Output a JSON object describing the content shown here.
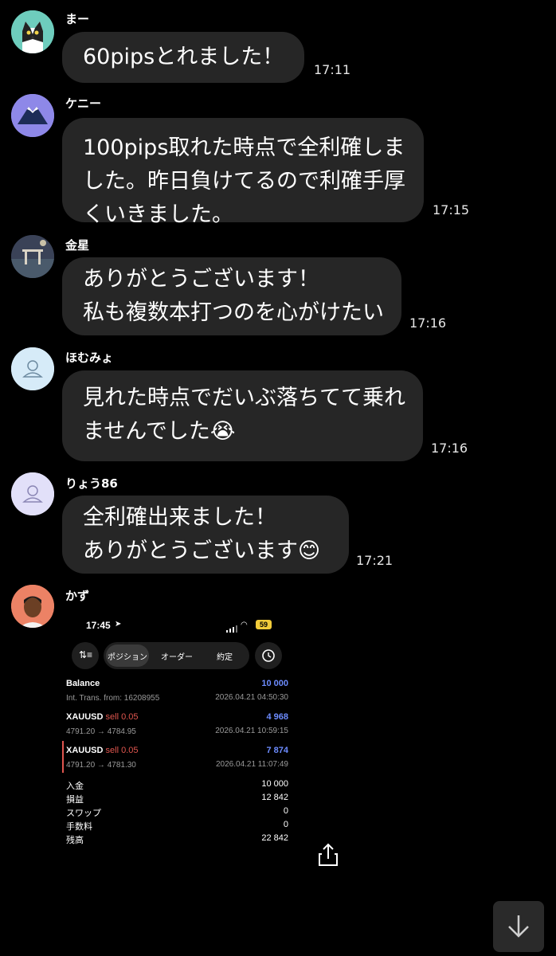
{
  "messages": [
    {
      "sender": "まー",
      "text": "60pipsとれました！",
      "time": "17:11"
    },
    {
      "sender": "ケニー",
      "text": "100pips取れた時点で全利確しま\nした。昨日負けてるので利確手厚\nくいきました。",
      "time": "17:15"
    },
    {
      "sender": "金星",
      "text": "ありがとうございます！\n私も複数本打つのを心がけたい",
      "time": "17:16"
    },
    {
      "sender": "ほむみょ",
      "text": "見れた時点でだいぶ落ちてて乗れ\nませんでした😭",
      "time": "17:16"
    },
    {
      "sender": "りょう86",
      "text": "全利確出来ました！\nありがとうございます😊",
      "time": "17:21"
    },
    {
      "sender": "かず"
    }
  ],
  "screenshot": {
    "status_time": "17:45",
    "battery": "59",
    "tabs": [
      "ポジション",
      "オーダー",
      "約定"
    ],
    "balance_label": "Balance",
    "balance_value": "10 000",
    "transfer_label": "Int. Trans. from: 16208955",
    "transfer_time": "2026.04.21 04:50:30",
    "positions": [
      {
        "symbol": "XAUUSD",
        "side": "sell 0.05",
        "profit": "4 968",
        "prices": "4791.20 → 4784.95",
        "time": "2026.04.21 10:59:15"
      },
      {
        "symbol": "XAUUSD",
        "side": "sell 0.05",
        "profit": "7 874",
        "prices": "4791.20 → 4781.30",
        "time": "2026.04.21 11:07:49"
      }
    ],
    "summary": [
      {
        "label": "入金",
        "value": "10 000"
      },
      {
        "label": "損益",
        "value": "12 842"
      },
      {
        "label": "スワップ",
        "value": "0"
      },
      {
        "label": "手数料",
        "value": "0"
      },
      {
        "label": "残高",
        "value": "22 842"
      }
    ]
  },
  "icons": {
    "share": "share-icon",
    "scroll_down": "arrow-down-icon",
    "clock": "clock-icon",
    "sort": "sort-icon"
  }
}
